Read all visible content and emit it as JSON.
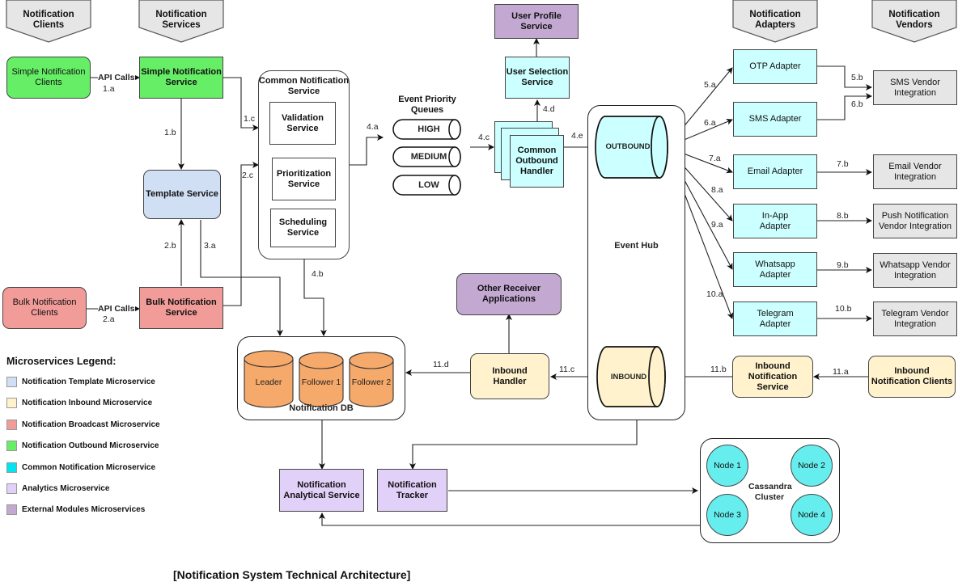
{
  "caption": "[Notification System Technical Architecture]",
  "headers": {
    "clients": "Notification Clients",
    "services": "Notification Services",
    "adapters": "Notification Adapters",
    "vendors": "Notification Vendors"
  },
  "clients": {
    "simple": "Simple Notification Clients",
    "bulk": "Bulk Notification Clients",
    "inbound": "Inbound Notification Clients"
  },
  "services": {
    "simple": "Simple Notification Service",
    "bulk": "Bulk Notification Service",
    "template": "Template Service",
    "inbound": "Inbound Notification Service",
    "user_selection": "User Selection Service",
    "user_profile": "User Profile Service",
    "other_receivers": "Other Receiver Applications",
    "inbound_handler": "Inbound Handler",
    "analytical": "Notification Analytical Service",
    "tracker": "Notification Tracker"
  },
  "common_service": {
    "title": "Common Notification Service",
    "validation": "Validation Service",
    "prioritization": "Prioritization Service",
    "scheduling": "Scheduling Service"
  },
  "queues": {
    "title": "Event Priority Queues",
    "items": [
      "HIGH",
      "MEDIUM",
      "LOW"
    ]
  },
  "outbound_handler": "Common Outbound Handler",
  "event_hub": {
    "title": "Event Hub",
    "outbound": "OUTBOUND",
    "inbound": "INBOUND"
  },
  "adapters": [
    "OTP Adapter",
    "SMS Adapter",
    "Email Adapter",
    "In-App Adapter",
    "Whatsapp Adapter",
    "Telegram Adapter"
  ],
  "vendors": [
    "SMS Vendor Integration",
    "Email Vendor Integration",
    "Push Notification Vendor Integration",
    "Whatsapp Vendor Integration",
    "Telegram Vendor Integration"
  ],
  "db": {
    "title": "Notification DB",
    "nodes": [
      "Leader",
      "Follower 1",
      "Follower 2"
    ]
  },
  "cassandra": {
    "title": "Cassandra Cluster",
    "nodes": [
      "Node 1",
      "Node 2",
      "Node 3",
      "Node 4"
    ]
  },
  "edges": {
    "api_calls": "API Calls",
    "e1a": "1.a",
    "e1b": "1.b",
    "e1c": "1.c",
    "e2a": "2.a",
    "e2b": "2.b",
    "e2c": "2.c",
    "e3a": "3.a",
    "e4a": "4.a",
    "e4b": "4.b",
    "e4c": "4.c",
    "e4d": "4.d",
    "e4e": "4.e",
    "e5a": "5.a",
    "e5b": "5.b",
    "e6a": "6.a",
    "e6b": "6.b",
    "e7a": "7.a",
    "e7b": "7.b",
    "e8a": "8.a",
    "e8b": "8.b",
    "e9a": "9.a",
    "e9b": "9.b",
    "e10a": "10.a",
    "e10b": "10.b",
    "e11a": "11.a",
    "e11b": "11.b",
    "e11c": "11.c",
    "e11d": "11.d"
  },
  "legend": {
    "title": "Microservices Legend:",
    "items": [
      {
        "label": "Notification Template Microservice",
        "color": "#d0dff3"
      },
      {
        "label": "Notification Inbound Microservice",
        "color": "#fff2cc"
      },
      {
        "label": "Notification Broadcast Microservice",
        "color": "#f19c99"
      },
      {
        "label": "Notification Outbound Microservice",
        "color": "#66ee66"
      },
      {
        "label": "Common Notification Microservice",
        "color": "#00e5ee"
      },
      {
        "label": "Analytics Microservice",
        "color": "#e1d0f8"
      },
      {
        "label": "External Modules Microservices",
        "color": "#c3a8d1"
      }
    ]
  }
}
